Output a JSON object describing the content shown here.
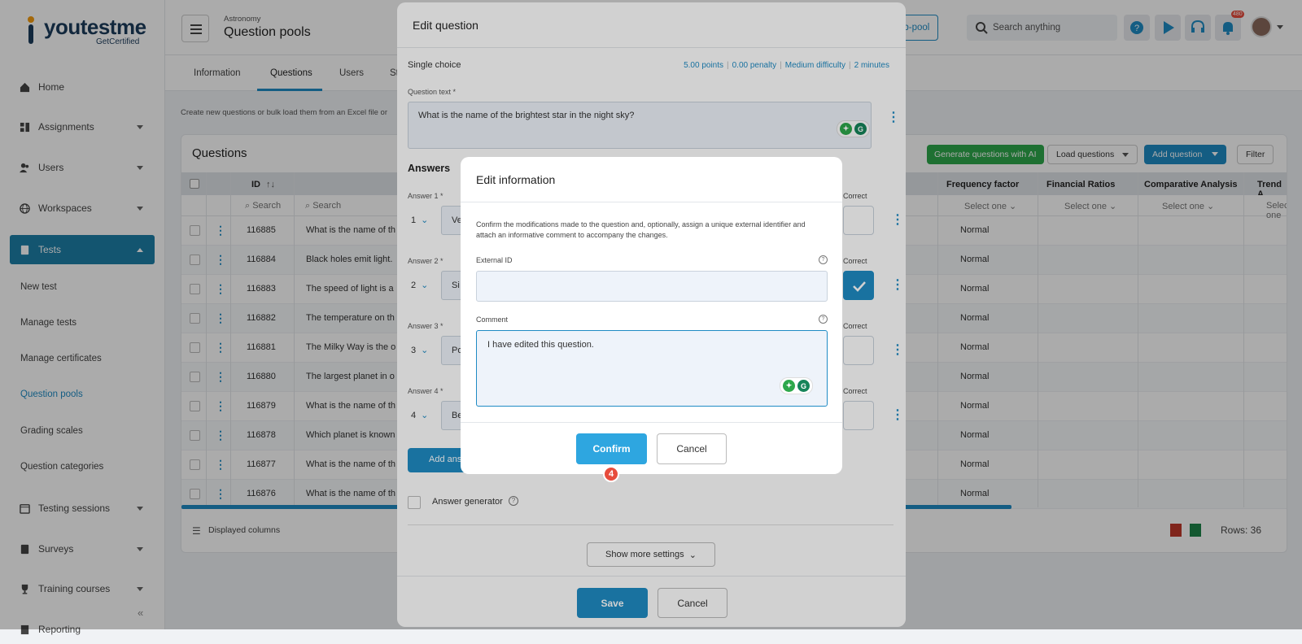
{
  "app": {
    "logo_text": "youtestme",
    "logo_sub": "GetCertified"
  },
  "sidebar": {
    "items": [
      {
        "label": "Home",
        "icon": "home-icon"
      },
      {
        "label": "Assignments",
        "icon": "assignments-icon"
      },
      {
        "label": "Users",
        "icon": "users-icon"
      },
      {
        "label": "Workspaces",
        "icon": "globe-icon"
      },
      {
        "label": "Tests",
        "icon": "tests-icon"
      },
      {
        "label": "Testing sessions",
        "icon": "calendar-icon"
      },
      {
        "label": "Surveys",
        "icon": "surveys-icon"
      },
      {
        "label": "Training courses",
        "icon": "trophy-icon"
      },
      {
        "label": "Reporting",
        "icon": "reporting-icon"
      }
    ],
    "sub_items": [
      "New test",
      "Manage tests",
      "Manage certificates",
      "Question pools",
      "Grading scales",
      "Question categories"
    ]
  },
  "header": {
    "breadcrumb": "Astronomy",
    "title": "Question pools",
    "sub_pool_label": "ub-pool",
    "search_placeholder": "Search anything",
    "notification_count": "480"
  },
  "tabs": [
    "Information",
    "Questions",
    "Users",
    "St"
  ],
  "questions_panel": {
    "description": "Create new questions or bulk load them from an Excel file or",
    "title": "Questions",
    "generate_btn": "Generate questions with AI",
    "load_btn": "Load questions",
    "add_btn": "Add question",
    "filter_btn": "Filter",
    "columns": {
      "id": "ID",
      "freq": "Frequency factor",
      "fin": "Financial Ratios",
      "comp": "Comparative Analysis",
      "trend": "Trend A"
    },
    "search_placeholder": "Search",
    "select_one": "Select one",
    "rows": [
      {
        "id": "116885",
        "text": "What is the name of th",
        "freq": "Normal"
      },
      {
        "id": "116884",
        "text": "Black holes emit light.",
        "freq": "Normal"
      },
      {
        "id": "116883",
        "text": "The speed of light is a",
        "freq": "Normal"
      },
      {
        "id": "116882",
        "text": "The temperature on th",
        "freq": "Normal"
      },
      {
        "id": "116881",
        "text": "The Milky Way is the o",
        "freq": "Normal"
      },
      {
        "id": "116880",
        "text": "The largest planet in o",
        "freq": "Normal"
      },
      {
        "id": "116879",
        "text": "What is the name of th",
        "freq": "Normal"
      },
      {
        "id": "116878",
        "text": "Which planet is known",
        "freq": "Normal"
      },
      {
        "id": "116877",
        "text": "What is the name of th",
        "freq": "Normal"
      },
      {
        "id": "116876",
        "text": "What is the name of th",
        "freq": "Normal"
      }
    ],
    "displayed_columns": "Displayed columns",
    "rows_count": "Rows: 36"
  },
  "edit_question": {
    "title": "Edit question",
    "type": "Single choice",
    "meta": [
      "5.00 points",
      "0.00 penalty",
      "Medium difficulty",
      "2 minutes"
    ],
    "question_label": "Question text *",
    "question_text": "What is the name of the brightest star in the night sky?",
    "answers_title": "Answers",
    "answers": [
      {
        "label": "Answer 1 *",
        "num": "1",
        "text": "Ve",
        "correct": false
      },
      {
        "label": "Answer 2 *",
        "num": "2",
        "text": "Si",
        "correct": true
      },
      {
        "label": "Answer 3 *",
        "num": "3",
        "text": "Po",
        "correct": false
      },
      {
        "label": "Answer 4 *",
        "num": "4",
        "text": "Be",
        "correct": false
      }
    ],
    "correct_label": "Correct",
    "add_answer": "Add ans",
    "answer_generator": "Answer generator",
    "show_more": "Show more settings",
    "save": "Save",
    "cancel": "Cancel"
  },
  "edit_info": {
    "title": "Edit information",
    "description": "Confirm the modifications made to the question and, optionally, assign a unique external identifier and attach an informative comment to accompany the changes.",
    "external_id_label": "External ID",
    "external_id_value": "",
    "comment_label": "Comment",
    "comment_value": "I have edited this question.",
    "confirm": "Confirm",
    "cancel": "Cancel",
    "step_number": "4"
  },
  "colors": {
    "accent": "#1f8bc4",
    "green": "#2ea84b",
    "badge": "#e74c3c"
  }
}
